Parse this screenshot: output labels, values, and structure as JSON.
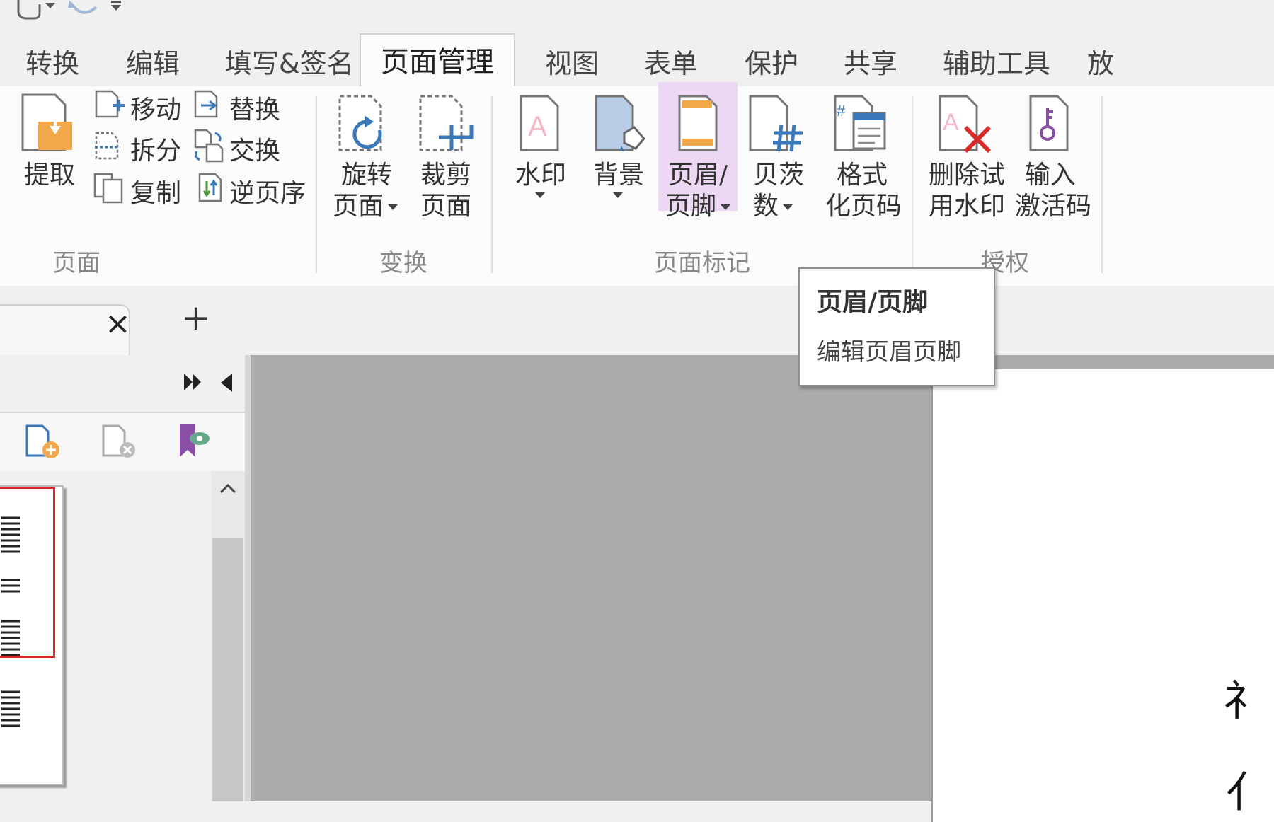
{
  "colors": {
    "accent_orange": "#f0a84b",
    "accent_blue": "#3a78b8",
    "accent_purple": "#8a4ea6",
    "accent_red": "#d92a2a",
    "highlight": "#ecd8f2"
  },
  "quick_access": {
    "icons": [
      "hand-tool-icon",
      "undo-icon",
      "customize-icon"
    ]
  },
  "ribbon_tabs": [
    "转换",
    "编辑",
    "填写&签名",
    "页面管理",
    "视图",
    "表单",
    "保护",
    "共享",
    "辅助工具",
    "放"
  ],
  "active_tab": "页面管理",
  "ribbon": {
    "page_group": {
      "label": "页面",
      "extract": "提取",
      "move": "移动",
      "replace": "替换",
      "split": "拆分",
      "swap": "交换",
      "copy": "复制",
      "reverse": "逆页序"
    },
    "transform_group": {
      "label": "变换",
      "rotate_1": "旋转",
      "rotate_2": "页面",
      "crop_1": "裁剪",
      "crop_2": "页面"
    },
    "mark_group": {
      "label": "页面标记",
      "watermark": "水印",
      "background": "背景",
      "header_footer_1": "页眉/",
      "header_footer_2": "页脚",
      "bates_1": "贝茨",
      "bates_2": "数",
      "format_1": "格式",
      "format_2": "化页码"
    },
    "license_group": {
      "label": "授权",
      "remove_trial_1": "删除试",
      "remove_trial_2": "用水印",
      "activate_1": "输入",
      "activate_2": "激活码"
    }
  },
  "tooltip": {
    "title": "页眉/页脚",
    "description": "编辑页眉页脚"
  },
  "doc_tabs": {
    "close": "×",
    "add": "+"
  },
  "page_right_glyphs": [
    "礻",
    "亻"
  ]
}
